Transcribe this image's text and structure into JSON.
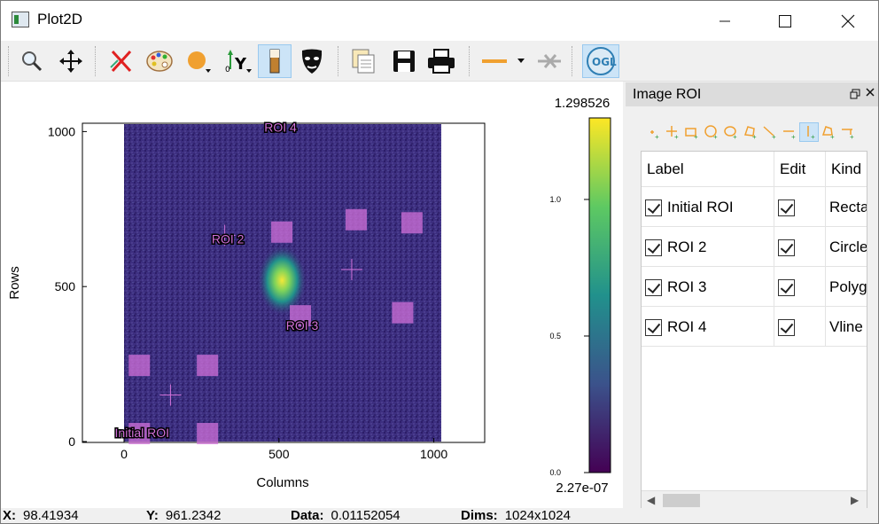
{
  "window": {
    "title": "Plot2D"
  },
  "toolbar": {
    "buttons": [
      "zoom-icon",
      "pan-icon",
      "reset-zoom-icon",
      "colormap-icon",
      "curve-style-icon",
      "y-axis-icon",
      "colorbar-icon",
      "mask-icon",
      "copy-icon",
      "save-icon",
      "print-icon",
      "profile-line-icon",
      "clear-profile-icon",
      "opengl-icon"
    ],
    "ogl_label": "OGL"
  },
  "plot": {
    "x_axis_label": "Columns",
    "y_axis_label": "Rows",
    "x_ticks": [
      "0",
      "500",
      "1000"
    ],
    "y_ticks": [
      "0",
      "500",
      "1000"
    ],
    "roi_labels": [
      "Initial ROI",
      "ROI 2",
      "ROI 3",
      "ROI 4"
    ]
  },
  "colorbar": {
    "max_label": "1.298526",
    "min_label": "2.27e-07",
    "ticks": [
      "1.0",
      "0.5",
      "0.0"
    ]
  },
  "chart_data": {
    "type": "heatmap",
    "xlabel": "Columns",
    "ylabel": "Rows",
    "xlim": [
      0,
      1024
    ],
    "ylim": [
      0,
      1024
    ],
    "colorbar_range": [
      2.27e-07,
      1.298526
    ],
    "colormap": "viridis",
    "peak": {
      "x": 510,
      "y": 520
    }
  },
  "dock": {
    "title": "Image ROI",
    "columns": [
      "Label",
      "Edit",
      "Kind"
    ],
    "rows": [
      {
        "label": "Initial ROI",
        "kind": "Rectar"
      },
      {
        "label": "ROI 2",
        "kind": "Circle"
      },
      {
        "label": "ROI 3",
        "kind": "Polyg"
      },
      {
        "label": "ROI 4",
        "kind": "Vline"
      }
    ]
  },
  "status": {
    "x_label": "X:",
    "x_value": "98.41934",
    "y_label": "Y:",
    "y_value": "961.2342",
    "data_label": "Data:",
    "data_value": "0.01152054",
    "dims_label": "Dims:",
    "dims_value": "1024x1024"
  },
  "colors": {
    "roi": "#d070d8",
    "selected": "#cce4f7",
    "tool_orange": "#f0a030"
  }
}
